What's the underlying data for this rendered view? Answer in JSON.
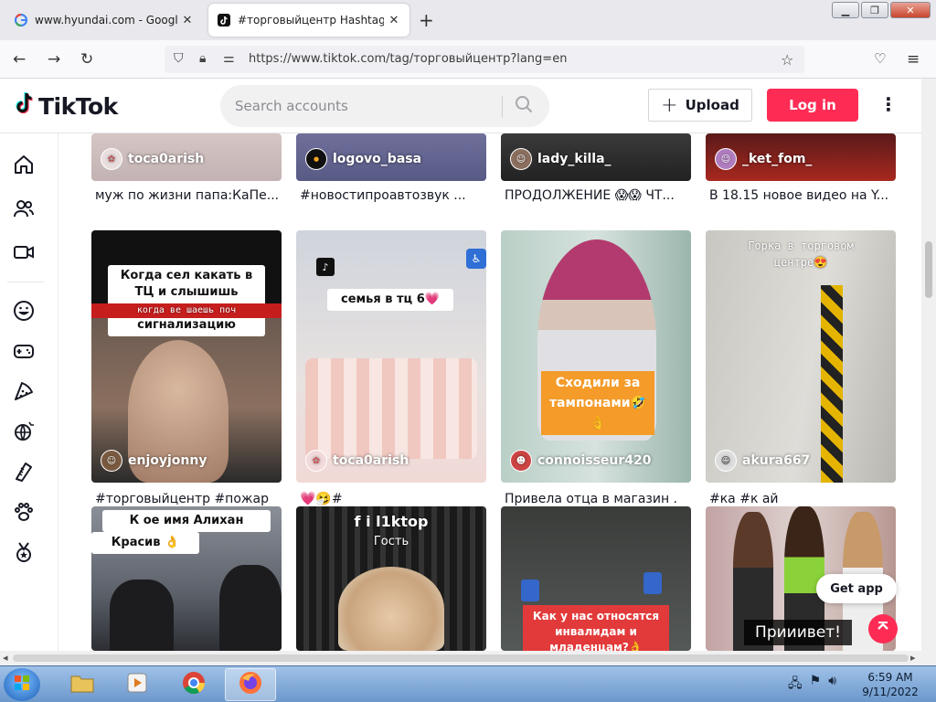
{
  "browser": {
    "tabs": [
      {
        "title": "www.hyundai.com - Google Se",
        "favicon": "google-g-icon"
      },
      {
        "title": "#торговыйцентр Hashtag Vide",
        "favicon": "tiktok-icon"
      }
    ],
    "new_tab": "+",
    "url": "https://www.tiktok.com/tag/торговыйцентр?lang=en",
    "window_buttons": {
      "minimize": "▁",
      "maximize": "❐",
      "close": "✕"
    }
  },
  "header": {
    "logo_text": "TikTok",
    "search_placeholder": "Search accounts",
    "upload_label": "Upload",
    "login_label": "Log in"
  },
  "sidebar": {
    "icons": [
      "home-icon",
      "following-icon",
      "live-icon",
      "comedy-icon",
      "gaming-icon",
      "food-icon",
      "sports-icon",
      "beauty-icon",
      "animals-icon",
      "achievement-icon"
    ]
  },
  "videos": {
    "row1": [
      {
        "user": "toca0arish",
        "desc": "муж по жизни папа:КаПе..."
      },
      {
        "user": "logovo_basa",
        "desc": "#новостипроавтозвук ..."
      },
      {
        "user": "lady_killa_",
        "desc": "ПРОДОЛЖЕНИЕ 😱😱 ЧТ..."
      },
      {
        "user": "_ket_fom_",
        "desc": "В 18.15 новое видео на Y..."
      }
    ],
    "row2": [
      {
        "user": "enjoyjonny",
        "desc": "#торговыйцентр #пожар",
        "overlay": "Когда сел какать в ТЦ и слышишь пожарную сигнализацию",
        "overlay_sub": "когда ве          шаешь поч"
      },
      {
        "user": "toca0arish",
        "desc": "💗🤧#",
        "overlay": "семья в тц 6💗"
      },
      {
        "user": "connoisseur420",
        "desc": "Привела отца в магазин .",
        "overlay": "Сходили за тампонами🤣👌"
      },
      {
        "user": "akura667",
        "desc": "#ка            #к   ай",
        "overlay": "Горка в торговом центре😍"
      }
    ],
    "row3": [
      {
        "overlay": "К      ое имя Алихан",
        "overlay2": "Красив   👌"
      },
      {
        "overlay": "f i l1ktop",
        "overlay2": "Гость"
      },
      {
        "overlay": "Как у нас относятся инвалидам и младенцам?👌"
      },
      {
        "overlay": "Прииивет!"
      }
    ]
  },
  "floating": {
    "get_app": "Get app",
    "to_top_icon": "arrow-up-icon"
  },
  "taskbar": {
    "time": "6:59 AM",
    "date": "9/11/2022"
  }
}
